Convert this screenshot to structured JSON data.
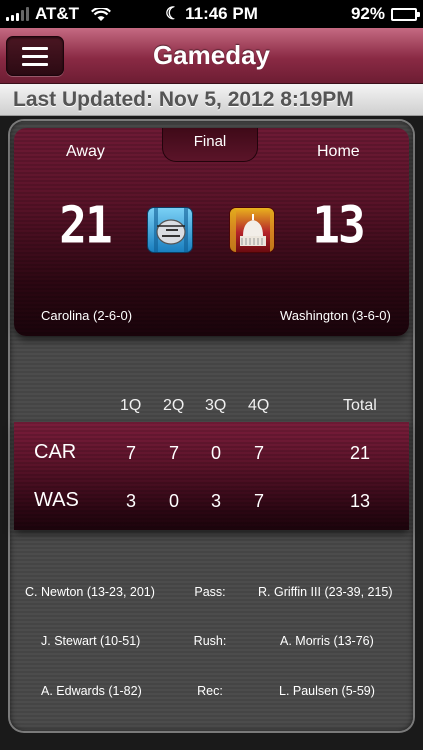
{
  "status_bar": {
    "carrier": "AT&T",
    "time": "11:46 PM",
    "battery_percent": "92%",
    "battery_level": 0.92
  },
  "nav": {
    "title": "Gameday",
    "menu_icon": "hamburger-menu-icon"
  },
  "last_updated": "Last Updated: Nov 5, 2012 8:19PM",
  "game": {
    "status": "Final",
    "away_label": "Away",
    "home_label": "Home",
    "away_score": "21",
    "home_score": "13",
    "away_team": "Carolina (2-6-0)",
    "home_team": "Washington (3-6-0)",
    "away_logo": "panthers-helmet-logo",
    "home_logo": "capitol-dome-logo"
  },
  "linescore": {
    "headers": [
      "1Q",
      "2Q",
      "3Q",
      "4Q",
      "Total"
    ],
    "rows": [
      {
        "team": "CAR",
        "q": [
          "7",
          "7",
          "0",
          "7"
        ],
        "total": "21"
      },
      {
        "team": "WAS",
        "q": [
          "3",
          "0",
          "3",
          "7"
        ],
        "total": "13"
      }
    ]
  },
  "leaders": [
    {
      "away": "C. Newton (13-23, 201)",
      "label": "Pass:",
      "home": "R. Griffin III (23-39, 215)"
    },
    {
      "away": "J. Stewart (10-51)",
      "label": "Rush:",
      "home": "A. Morris (13-76)"
    },
    {
      "away": "A. Edwards (1-82)",
      "label": "Rec:",
      "home": "L. Paulsen (5-59)"
    }
  ],
  "colors": {
    "accent": "#8a2a44",
    "card_dark": "#2c0712"
  }
}
